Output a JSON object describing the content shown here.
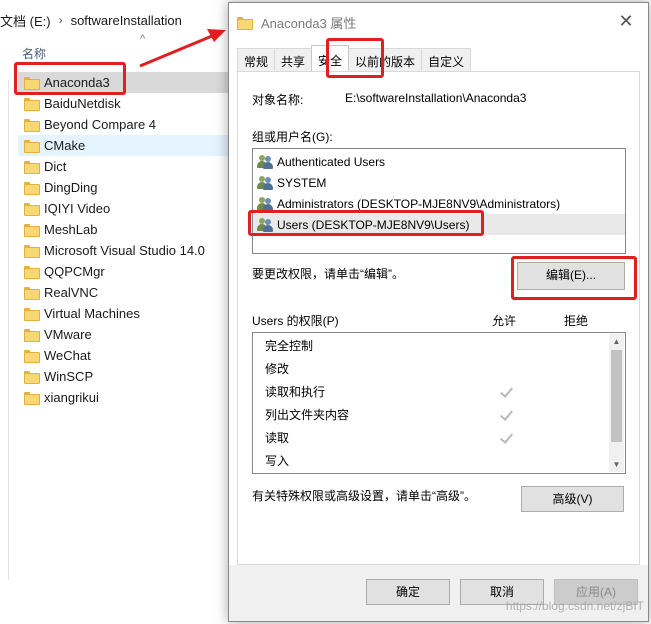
{
  "explorer": {
    "breadcrumb": [
      "文档 (E:)",
      "softwareInstallation"
    ],
    "breadcrumb_sep": "›",
    "column_name_header": "名称",
    "sort_arrow": "^",
    "folders": [
      {
        "name": "Anaconda3",
        "state": "selected"
      },
      {
        "name": "BaiduNetdisk",
        "state": ""
      },
      {
        "name": "Beyond Compare 4",
        "state": ""
      },
      {
        "name": "CMake",
        "state": "hover"
      },
      {
        "name": "Dict",
        "state": ""
      },
      {
        "name": "DingDing",
        "state": ""
      },
      {
        "name": "IQIYI Video",
        "state": ""
      },
      {
        "name": "MeshLab",
        "state": ""
      },
      {
        "name": "Microsoft Visual Studio 14.0",
        "state": ""
      },
      {
        "name": "QQPCMgr",
        "state": ""
      },
      {
        "name": "RealVNC",
        "state": ""
      },
      {
        "name": "Virtual Machines",
        "state": ""
      },
      {
        "name": "VMware",
        "state": ""
      },
      {
        "name": "WeChat",
        "state": ""
      },
      {
        "name": "WinSCP",
        "state": ""
      },
      {
        "name": "xiangrikui",
        "state": ""
      }
    ]
  },
  "dialog": {
    "title": "Anaconda3 属性",
    "close_glyph": "✕",
    "tabs": [
      {
        "label": "常规",
        "active": false
      },
      {
        "label": "共享",
        "active": false
      },
      {
        "label": "安全",
        "active": true
      },
      {
        "label": "以前的版本",
        "active": false
      },
      {
        "label": "自定义",
        "active": false
      }
    ],
    "object_name_label": "对象名称:",
    "object_name_value": "E:\\softwareInstallation\\Anaconda3",
    "group_label": "组或用户名(G):",
    "users": [
      {
        "name": "Authenticated Users",
        "selected": false
      },
      {
        "name": "SYSTEM",
        "selected": false
      },
      {
        "name": "Administrators (DESKTOP-MJE8NV9\\Administrators)",
        "selected": false
      },
      {
        "name": "Users (DESKTOP-MJE8NV9\\Users)",
        "selected": true
      }
    ],
    "change_hint": "要更改权限，请单击“编辑”。",
    "edit_button": "编辑(E)...",
    "perm_header": "Users 的权限(P)",
    "allow_header": "允许",
    "deny_header": "拒绝",
    "permissions": [
      {
        "name": "完全控制",
        "allow": false,
        "deny": false
      },
      {
        "name": "修改",
        "allow": false,
        "deny": false
      },
      {
        "name": "读取和执行",
        "allow": true,
        "deny": false
      },
      {
        "name": "列出文件夹内容",
        "allow": true,
        "deny": false
      },
      {
        "name": "读取",
        "allow": true,
        "deny": false
      },
      {
        "name": "写入",
        "allow": false,
        "deny": false
      }
    ],
    "advanced_hint": "有关特殊权限或高级设置，请单击“高级”。",
    "advanced_button": "高级(V)",
    "ok_button": "确定",
    "cancel_button": "取消",
    "apply_button": "应用(A)",
    "scroll_up_glyph": "▲",
    "scroll_down_glyph": "▼"
  },
  "watermark": "https://blog.csdn.net/zjBIT",
  "colors": {
    "annotation_red": "#e02020",
    "folder_yellow": "#f8d775"
  }
}
